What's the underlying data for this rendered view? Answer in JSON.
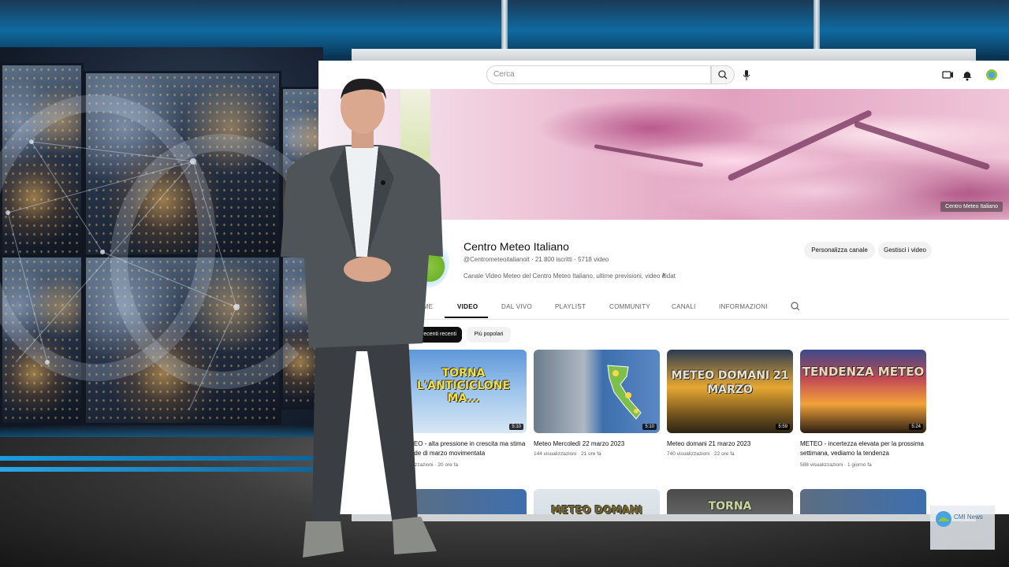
{
  "youtube": {
    "search_placeholder": "Cerca",
    "channel_name": "Centro Meteo Italiano",
    "channel_meta": "@Centrometeoitalianoit · 21.800 iscritti · 5718 video",
    "channel_description": "Canale Video Meteo del Centro Meteo Italiano, ultime previsioni, video didat",
    "banner_tag": "Centro Meteo Italiano",
    "buttons": {
      "customize": "Personalizza canale",
      "manage": "Gestisci i video"
    },
    "tabs": [
      "HOME",
      "VIDEO",
      "DAL VIVO",
      "PLAYLIST",
      "COMMUNITY",
      "CANALI",
      "INFORMAZIONI"
    ],
    "active_tab": "VIDEO",
    "chips": [
      "Più recenti recenti",
      "Più popolari"
    ],
    "videos": [
      {
        "thumb_text": "TORNA L'ANTICICLONE MA...",
        "duration": "5:10",
        "title": "METEO - alta pressione in crescita ma stima decade di marzo movimentata",
        "meta": "visualizzazioni · 20 ore fa"
      },
      {
        "thumb_text": "",
        "duration": "5:10",
        "title": "Meteo Mercoledì 22 marzo 2023",
        "meta": "144 visualizzazioni · 21 ore fa"
      },
      {
        "thumb_text": "METEO DOMANI 21 MARZO",
        "duration": "5:59",
        "title": "Meteo domani 21 marzo 2023",
        "meta": "740 visualizzazioni · 22 ore fa"
      },
      {
        "thumb_text": "TENDENZA METEO",
        "duration": "5:24",
        "title": "METEO - incertezza elevata per la prossima settimana, vediamo la tendenza",
        "meta": "588 visualizzazioni · 1 giorno fa"
      }
    ],
    "row2_thumbs": [
      "",
      "METEO DOMANI",
      "TORNA",
      ""
    ]
  },
  "studio_badge": "CMI News",
  "colors": {
    "yt_red": "#ff0000",
    "studio_blue": "#0f6aa0",
    "logo_green": "#8cc63f"
  }
}
